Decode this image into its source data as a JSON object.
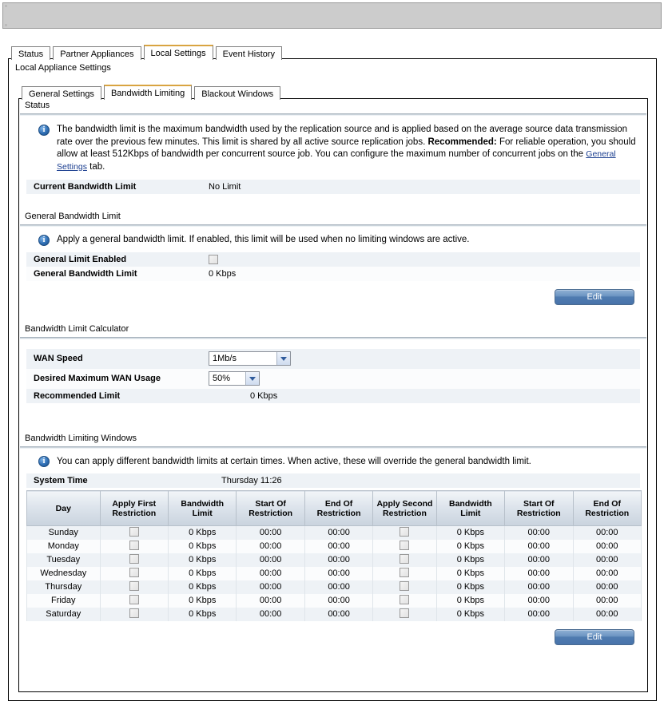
{
  "window": {
    "title_bar_color": "#cccccc"
  },
  "tabs": {
    "items": [
      {
        "label": "Status",
        "active": false
      },
      {
        "label": "Partner Appliances",
        "active": false
      },
      {
        "label": "Local Settings",
        "active": true
      },
      {
        "label": "Event History",
        "active": false
      }
    ]
  },
  "panel": {
    "title": "Local Appliance Settings"
  },
  "subtabs": {
    "items": [
      {
        "label": "General Settings",
        "active": false
      },
      {
        "label": "Bandwidth Limiting",
        "active": true
      },
      {
        "label": "Blackout Windows",
        "active": false
      }
    ]
  },
  "status_section": {
    "heading": "Status",
    "info_text_1": "The bandwidth limit is the maximum bandwidth used by the replication source and is applied based on the average source data transmission rate over the previous few minutes. This limit is shared by all active source replication jobs. ",
    "info_bold": "Recommended:",
    "info_text_2": " For reliable operation, you should allow at least 512Kbps of bandwidth per concurrent source job. You can configure the maximum number of concurrent jobs on the ",
    "info_link": "General Settings",
    "info_text_3": " tab.",
    "current_limit_label": "Current Bandwidth Limit",
    "current_limit_value": "No Limit"
  },
  "general_limit_section": {
    "heading": "General Bandwidth Limit",
    "info_text": "Apply a general bandwidth limit. If enabled, this limit will be used when no limiting windows are active.",
    "enabled_label": "General Limit Enabled",
    "enabled_checked": false,
    "limit_label": "General Bandwidth Limit",
    "limit_value": "0 Kbps",
    "edit_label": "Edit"
  },
  "calculator_section": {
    "heading": "Bandwidth Limit Calculator",
    "wan_speed_label": "WAN Speed",
    "wan_speed_value": "1Mb/s",
    "wan_usage_label": "Desired Maximum WAN Usage",
    "wan_usage_value": "50%",
    "recommended_label": "Recommended Limit",
    "recommended_value": "0 Kbps"
  },
  "windows_section": {
    "heading": "Bandwidth Limiting Windows",
    "info_text": "You can apply different bandwidth limits at certain times. When active, these will override the general bandwidth limit.",
    "system_time_label": "System Time",
    "system_time_value": "Thursday 11:26",
    "edit_label": "Edit",
    "table": {
      "columns": [
        "Day",
        "Apply First Restriction",
        "Bandwidth Limit",
        "Start Of Restriction",
        "End Of Restriction",
        "Apply Second Restriction",
        "Bandwidth Limit",
        "Start Of Restriction",
        "End Of Restriction"
      ],
      "rows": [
        {
          "day": "Sunday",
          "apply_first": false,
          "bw1": "0 Kbps",
          "start1": "00:00",
          "end1": "00:00",
          "apply_second": false,
          "bw2": "0 Kbps",
          "start2": "00:00",
          "end2": "00:00"
        },
        {
          "day": "Monday",
          "apply_first": false,
          "bw1": "0 Kbps",
          "start1": "00:00",
          "end1": "00:00",
          "apply_second": false,
          "bw2": "0 Kbps",
          "start2": "00:00",
          "end2": "00:00"
        },
        {
          "day": "Tuesday",
          "apply_first": false,
          "bw1": "0 Kbps",
          "start1": "00:00",
          "end1": "00:00",
          "apply_second": false,
          "bw2": "0 Kbps",
          "start2": "00:00",
          "end2": "00:00"
        },
        {
          "day": "Wednesday",
          "apply_first": false,
          "bw1": "0 Kbps",
          "start1": "00:00",
          "end1": "00:00",
          "apply_second": false,
          "bw2": "0 Kbps",
          "start2": "00:00",
          "end2": "00:00"
        },
        {
          "day": "Thursday",
          "apply_first": false,
          "bw1": "0 Kbps",
          "start1": "00:00",
          "end1": "00:00",
          "apply_second": false,
          "bw2": "0 Kbps",
          "start2": "00:00",
          "end2": "00:00"
        },
        {
          "day": "Friday",
          "apply_first": false,
          "bw1": "0 Kbps",
          "start1": "00:00",
          "end1": "00:00",
          "apply_second": false,
          "bw2": "0 Kbps",
          "start2": "00:00",
          "end2": "00:00"
        },
        {
          "day": "Saturday",
          "apply_first": false,
          "bw1": "0 Kbps",
          "start1": "00:00",
          "end1": "00:00",
          "apply_second": false,
          "bw2": "0 Kbps",
          "start2": "00:00",
          "end2": "00:00"
        }
      ]
    }
  },
  "colors": {
    "active_tab_accent": "#d9a441",
    "button_blue": "#4f7cb0",
    "info_blue": "#2f6fb5"
  }
}
